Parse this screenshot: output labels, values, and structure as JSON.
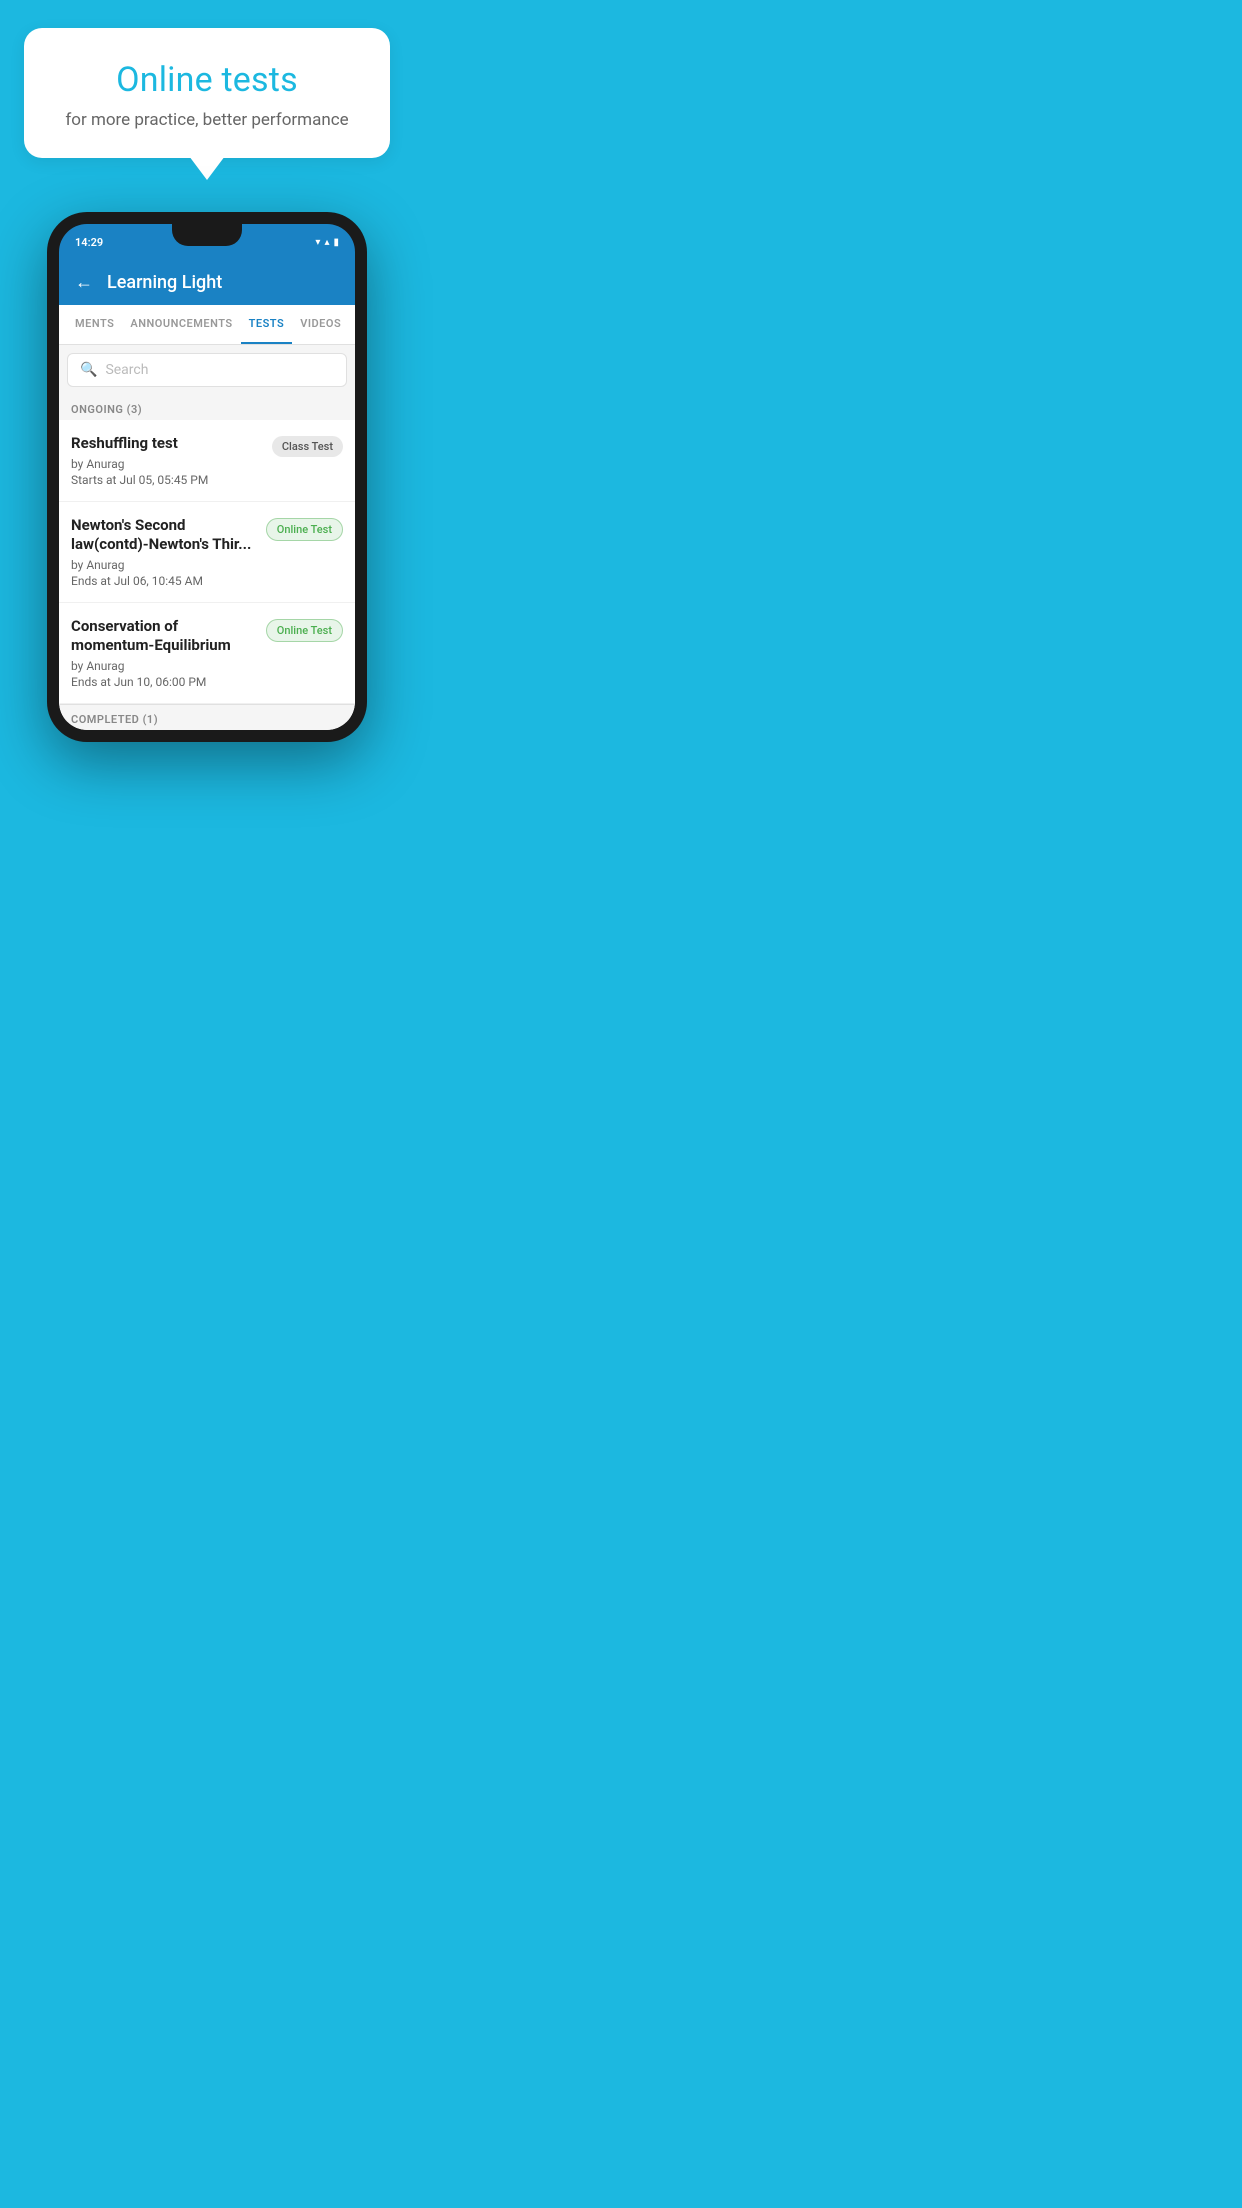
{
  "background_color": "#1cb8e0",
  "speech_bubble": {
    "title": "Online tests",
    "subtitle": "for more practice, better performance"
  },
  "phone": {
    "status_bar": {
      "time": "14:29",
      "wifi_icon": "▼",
      "signal_icon": "▲",
      "battery_icon": "▮"
    },
    "app_bar": {
      "back_label": "←",
      "title": "Learning Light"
    },
    "tabs": [
      {
        "label": "MENTS",
        "active": false
      },
      {
        "label": "ANNOUNCEMENTS",
        "active": false
      },
      {
        "label": "TESTS",
        "active": true
      },
      {
        "label": "VIDEOS",
        "active": false
      }
    ],
    "search": {
      "placeholder": "Search"
    },
    "ongoing_section": {
      "header": "ONGOING (3)",
      "tests": [
        {
          "name": "Reshuffling test",
          "by": "by Anurag",
          "date": "Starts at  Jul 05, 05:45 PM",
          "badge": "Class Test",
          "badge_type": "class"
        },
        {
          "name": "Newton's Second law(contd)-Newton's Thir...",
          "by": "by Anurag",
          "date": "Ends at  Jul 06, 10:45 AM",
          "badge": "Online Test",
          "badge_type": "online"
        },
        {
          "name": "Conservation of momentum-Equilibrium",
          "by": "by Anurag",
          "date": "Ends at  Jun 10, 06:00 PM",
          "badge": "Online Test",
          "badge_type": "online"
        }
      ]
    },
    "completed_section": {
      "header": "COMPLETED (1)"
    }
  }
}
